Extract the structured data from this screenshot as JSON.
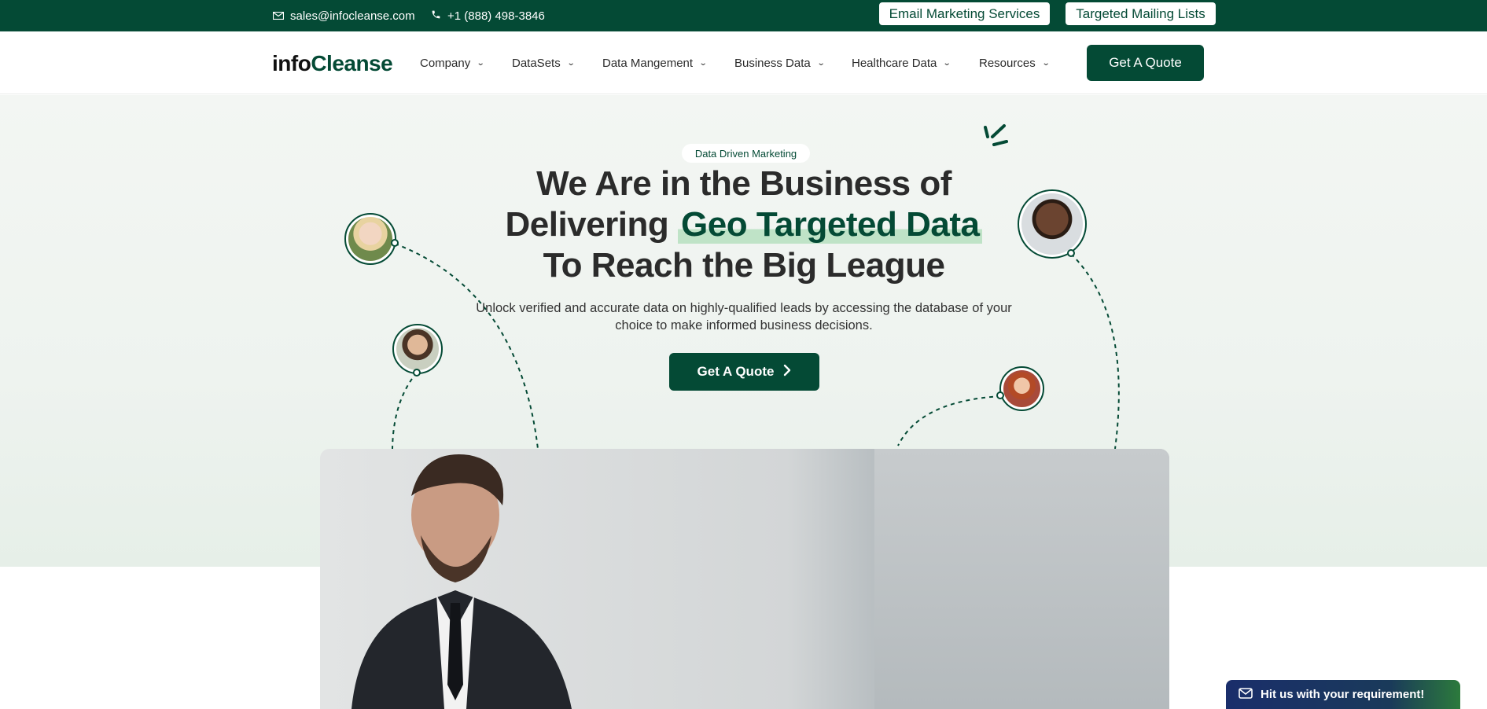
{
  "topbar": {
    "email": "sales@infocleanse.com",
    "phone": "+1 (888) 498-3846",
    "links": [
      "Email Marketing Services",
      "Targeted Mailing Lists"
    ]
  },
  "header": {
    "logo": {
      "info": "info",
      "cleanse": "Cleanse"
    },
    "nav": [
      "Company",
      "DataSets",
      "Data Mangement",
      "Business Data",
      "Healthcare Data",
      "Resources"
    ],
    "cta": "Get A Quote"
  },
  "hero": {
    "badge": "Data Driven Marketing",
    "headline_line1": "We Are in the Business of",
    "headline_line2_prefix": "Delivering",
    "headline_accent": "Geo Targeted Data",
    "headline_line3": "To Reach the Big League",
    "subtext": "Unlock verified and accurate data on highly-qualified leads by accessing the database of your choice to make informed business decisions.",
    "cta": "Get A Quote"
  },
  "chat": {
    "label": "Hit us with your requirement!"
  },
  "colors": {
    "brand": "#044a35",
    "accent_highlight": "#bfe3c7",
    "hero_bg": "#eef3ef"
  },
  "icons": {
    "email": "envelope-icon",
    "phone": "phone-icon",
    "nav_chevron": "chevron-down-icon",
    "cta_arrow": "chevron-right-icon",
    "chat": "mail-icon"
  }
}
